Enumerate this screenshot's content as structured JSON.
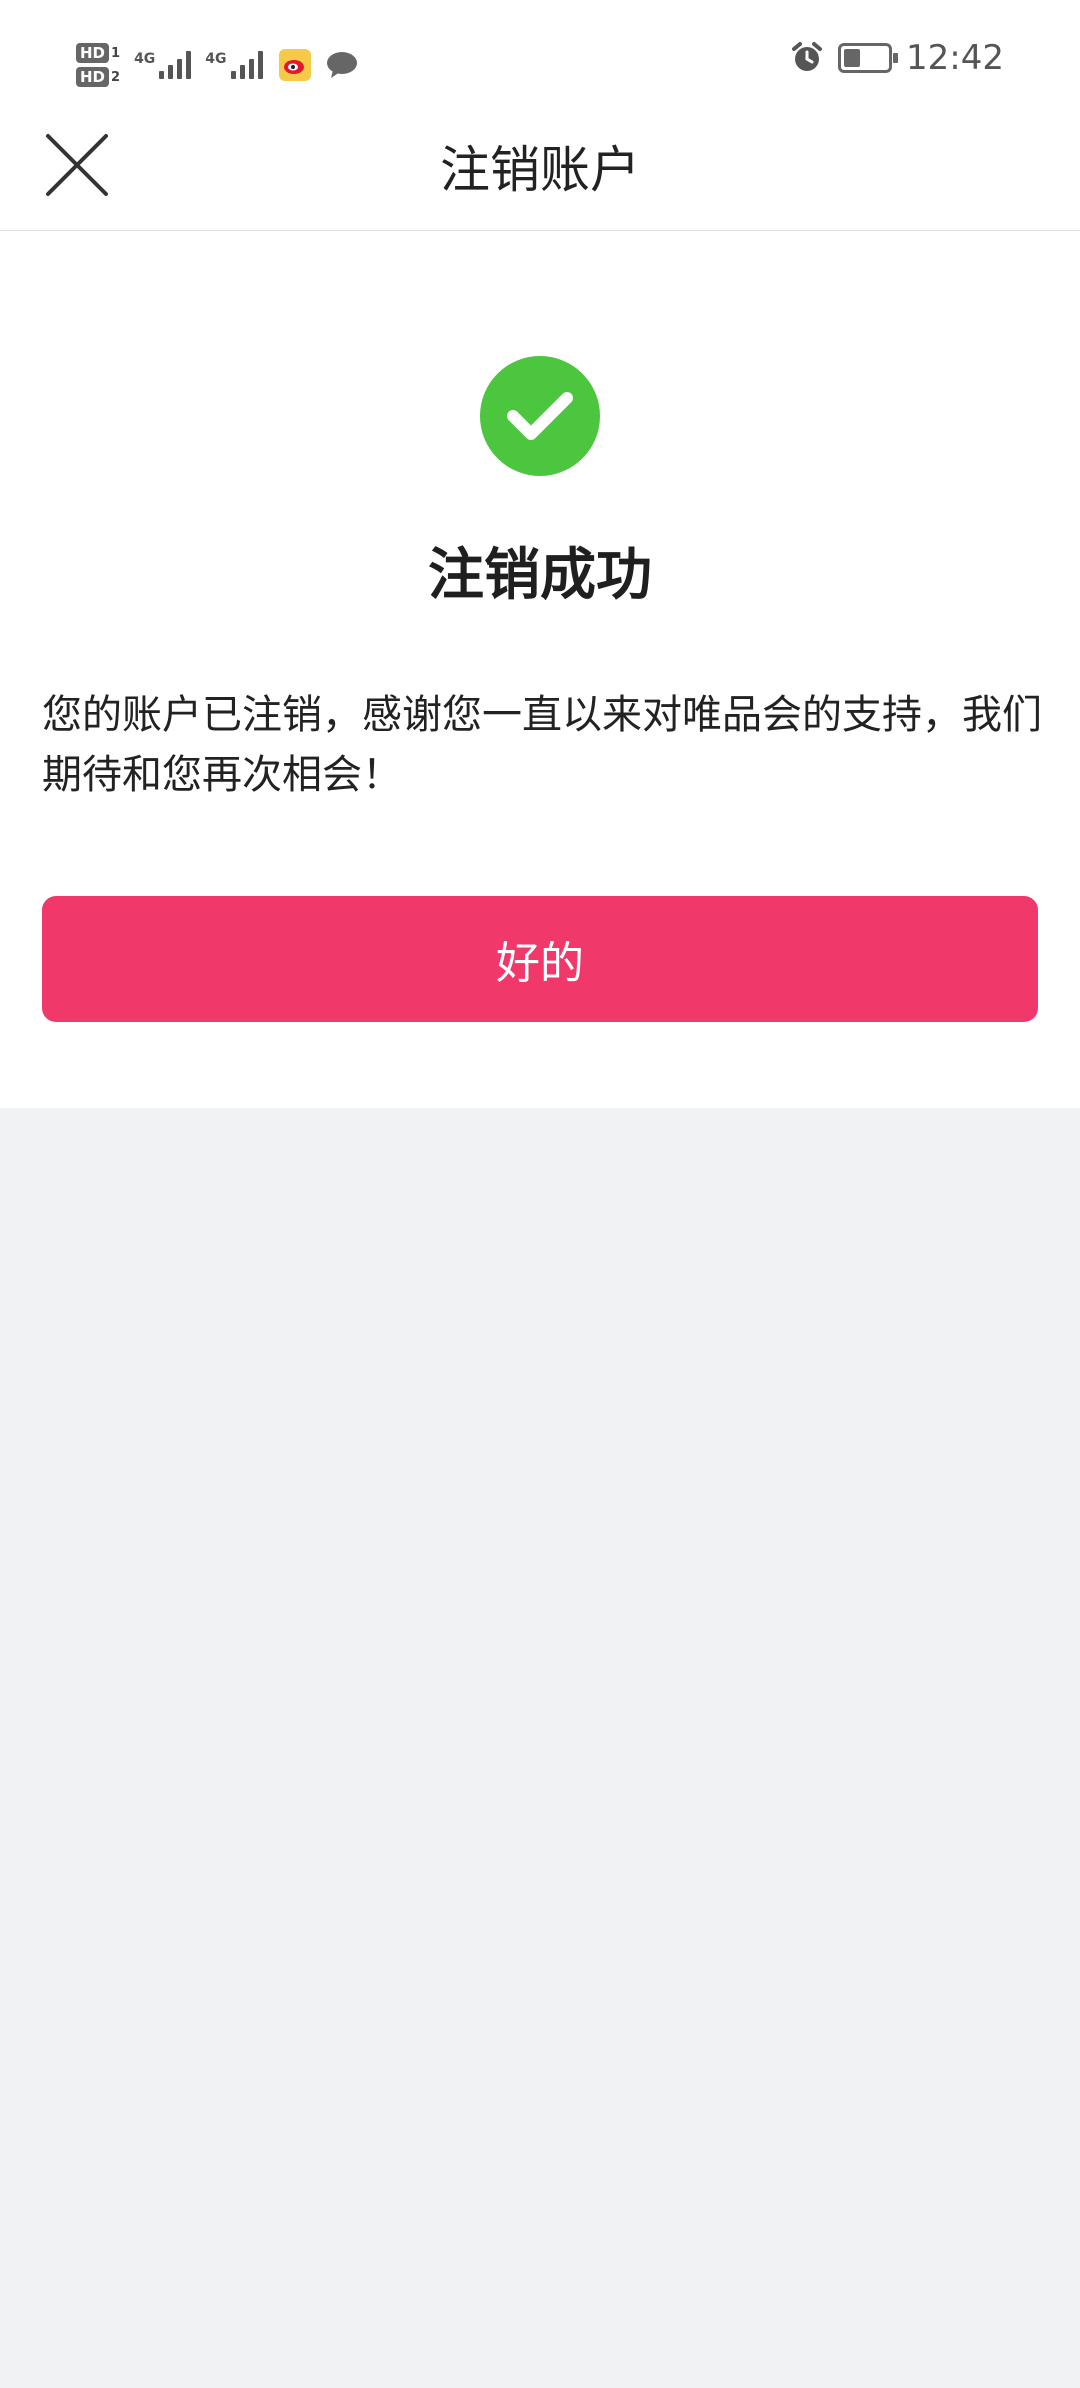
{
  "status_bar": {
    "hd1": "HD",
    "hd1_num": "1",
    "hd2": "HD",
    "hd2_num": "2",
    "net1": "4G",
    "net2": "4G",
    "time": "12:42"
  },
  "nav": {
    "title": "注销账户"
  },
  "content": {
    "success_title": "注销成功",
    "message": "您的账户已注销，感谢您一直以来对唯品会的支持，我们期待和您再次相会！",
    "ok_label": "好的"
  },
  "colors": {
    "accent": "#f0396a",
    "success": "#4cc53f",
    "background": "#f1f2f4"
  },
  "icons": [
    "close-icon",
    "check-icon",
    "alarm-icon",
    "battery-icon",
    "weibo-icon",
    "message-icon"
  ]
}
